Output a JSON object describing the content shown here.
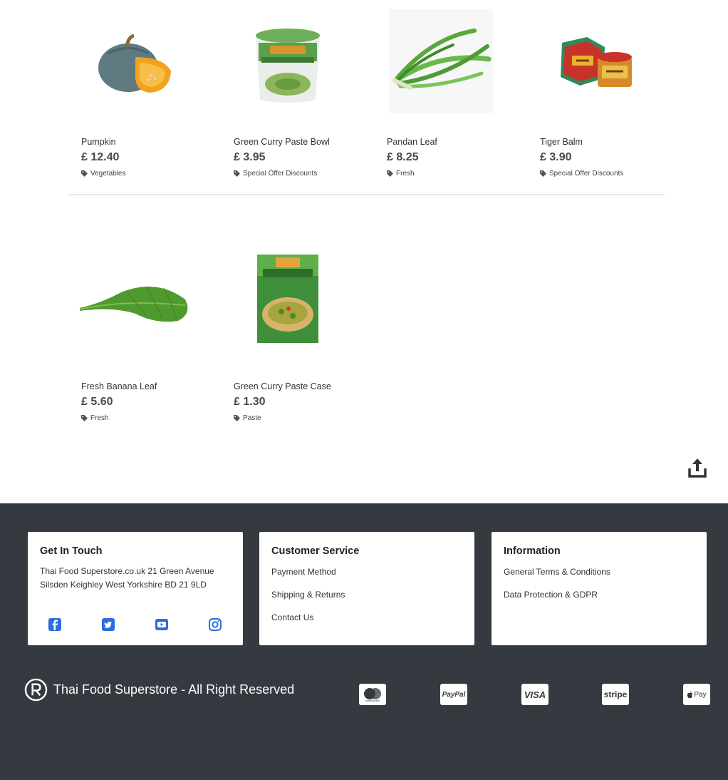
{
  "products": [
    {
      "name": "Pumpkin",
      "price": "£ 12.40",
      "tag": "Vegetables",
      "image": "pumpkin"
    },
    {
      "name": "Green Curry Paste Bowl",
      "price": "£ 3.95",
      "tag": "Special Offer Discounts",
      "image": "curry-paste-tub"
    },
    {
      "name": "Pandan Leaf",
      "price": "£ 8.25",
      "tag": "Fresh",
      "image": "pandan-leaf"
    },
    {
      "name": "Tiger Balm",
      "price": "£ 3.90",
      "tag": "Special Offer Discounts",
      "image": "tiger-balm"
    },
    {
      "name": "Fresh Banana Leaf",
      "price": "£ 5.60",
      "tag": "Fresh",
      "image": "banana-leaf"
    },
    {
      "name": "Green Curry Paste Case",
      "price": "£ 1.30",
      "tag": "Paste",
      "image": "curry-paste-box"
    }
  ],
  "icons": {
    "tag": "tag-icon",
    "share": "share-icon"
  },
  "footer": {
    "get_in_touch": {
      "title": "Get In Touch",
      "address_line1": "Thai Food Superstore.co.uk 21 Green Avenue",
      "address_line2": "Silsden Keighley West Yorkshire BD 21 9LD",
      "social": [
        "facebook",
        "twitter",
        "youtube",
        "instagram"
      ]
    },
    "customer_service": {
      "title": "Customer Service",
      "links": [
        "Payment Method",
        "Shipping & Returns",
        "Contact Us"
      ]
    },
    "information": {
      "title": "Information",
      "links": [
        "General Terms & Conditions",
        "Data Protection & GDPR"
      ]
    },
    "copyright": "Thai Food Superstore - All Right Reserved",
    "payments": {
      "mastercard": "mastercard",
      "paypal": "PayPal",
      "visa": "VISA",
      "stripe": "stripe",
      "applepay": "Pay"
    }
  },
  "colors": {
    "footer_bg": "#343a40",
    "social_blue": "#2d6cdf",
    "price_text": "#4a4a4a"
  }
}
